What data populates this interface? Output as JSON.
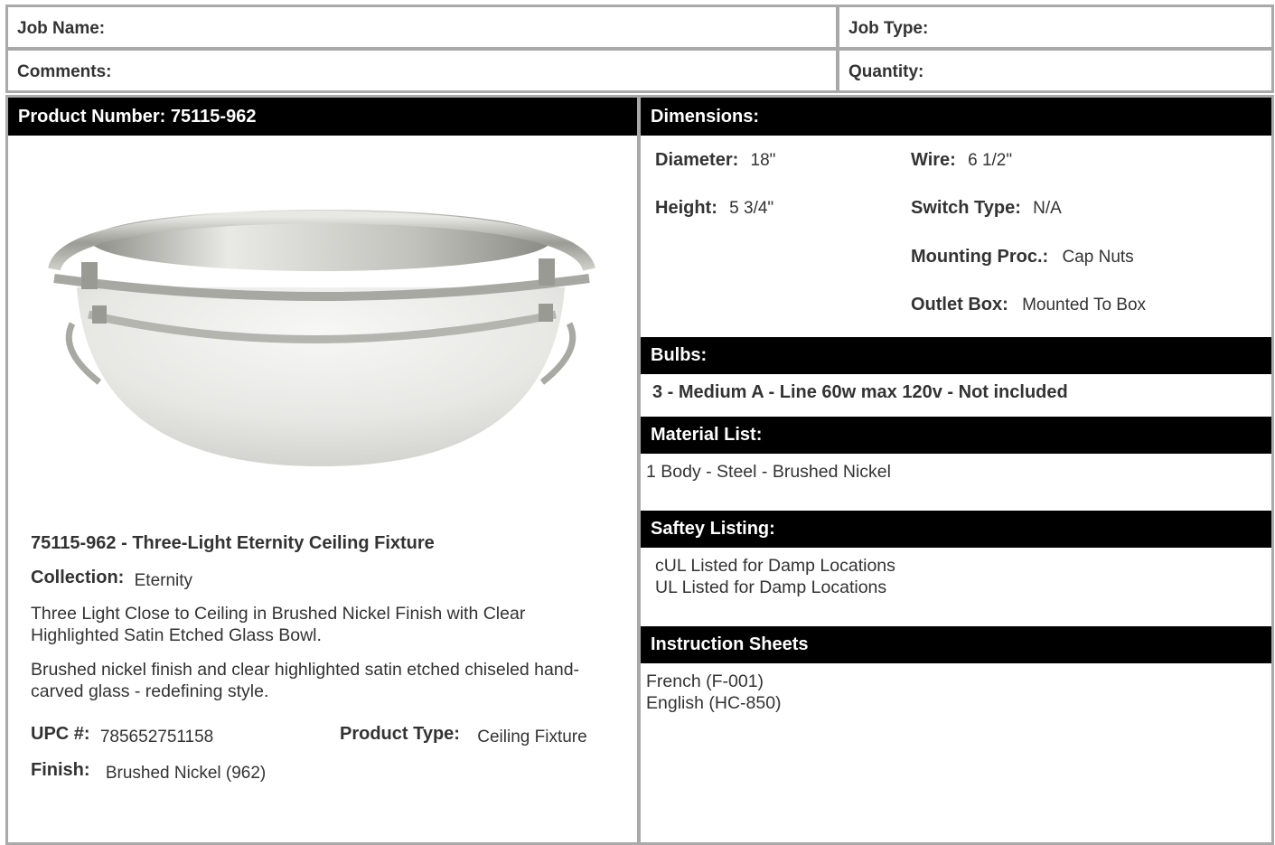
{
  "header": {
    "job_name_label": "Job Name:",
    "job_type_label": "Job Type:",
    "comments_label": "Comments:",
    "quantity_label": "Quantity:"
  },
  "product": {
    "number_heading": "Product Number: 75115-962",
    "image_name": "ceiling-fixture-photo",
    "title": "75115-962 - Three-Light Eternity Ceiling Fixture",
    "collection_label": "Collection:",
    "collection_value": "Eternity",
    "description_1": "Three Light Close to Ceiling in Brushed Nickel Finish with Clear Highlighted Satin Etched Glass Bowl.",
    "description_2": "Brushed nickel finish and clear highlighted satin etched chiseled hand-carved glass - redefining style.",
    "upc_label": "UPC #:",
    "upc_value": "785652751158",
    "type_label": "Product Type:",
    "type_value": "Ceiling Fixture",
    "finish_label": "Finish:",
    "finish_value": "Brushed Nickel (962)"
  },
  "dimensions": {
    "heading": "Dimensions:",
    "diameter_label": "Diameter:",
    "diameter_value": "18\"",
    "height_label": "Height:",
    "height_value": "5 3/4\"",
    "wire_label": "Wire:",
    "wire_value": "6 1/2\"",
    "switch_label": "Switch Type:",
    "switch_value": "N/A",
    "mounting_label": "Mounting Proc.:",
    "mounting_value": "Cap Nuts",
    "outlet_label": "Outlet Box:",
    "outlet_value": "Mounted To Box"
  },
  "bulbs": {
    "heading": "Bulbs:",
    "text": "3 - Medium A - Line 60w max 120v - Not included"
  },
  "materials": {
    "heading": "Material List:",
    "items": [
      "1 Body - Steel - Brushed Nickel"
    ]
  },
  "safety": {
    "heading": "Saftey Listing:",
    "items": [
      "cUL Listed for Damp Locations",
      "UL Listed for Damp Locations"
    ]
  },
  "instructions": {
    "heading": "Instruction Sheets",
    "items": [
      "French (F-001)",
      "English (HC-850)"
    ]
  }
}
